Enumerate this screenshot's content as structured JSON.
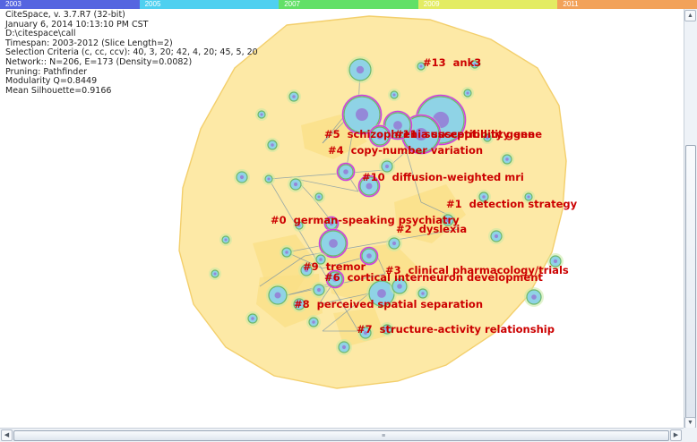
{
  "timeline": {
    "years": [
      {
        "label": "2003",
        "color": "#5565e0"
      },
      {
        "label": "2005",
        "color": "#4fd0f0"
      },
      {
        "label": "2007",
        "color": "#62e067"
      },
      {
        "label": "2009",
        "color": "#e3ec63"
      },
      {
        "label": "2011",
        "color": "#f2a25a"
      }
    ]
  },
  "info": {
    "title": "CiteSpace, v. 3.7.R7 (32-bit)",
    "date": "January 6, 2014 10:13:10 PM CST",
    "path": "D:\\citespace\\call",
    "timespan": "Timespan: 2003-2012 (Slice Length=2)",
    "criteria": "Selection Criteria (c, cc, ccv): 40, 3, 20; 42, 4, 20; 45, 5, 20",
    "network": "Network:: N=206, E=173 (Density=0.0082)",
    "pruning": "Pruning: Pathfinder",
    "modularity": "Modularity Q=0.8449",
    "silhouette": "Mean Silhouette=0.9166"
  },
  "clusters": [
    {
      "id": "#13",
      "label": "ank3"
    },
    {
      "id": "#11",
      "label": "susceptibility gene"
    },
    {
      "id": "#5",
      "label": "schizophrenia susceptibility gene"
    },
    {
      "id": "#4",
      "label": "copy-number variation"
    },
    {
      "id": "#10",
      "label": "diffusion-weighted mri"
    },
    {
      "id": "#1",
      "label": "detection strategy"
    },
    {
      "id": "#0",
      "label": "german-speaking psychiatry"
    },
    {
      "id": "#2",
      "label": "dyslexia"
    },
    {
      "id": "#9",
      "label": "tremor"
    },
    {
      "id": "#3",
      "label": "clinical pharmacology/trials"
    },
    {
      "id": "#6",
      "label": "cortical interneuron development"
    },
    {
      "id": "#8",
      "label": "perceived spatial separation"
    },
    {
      "id": "#7",
      "label": "structure-activity relationship"
    }
  ],
  "colors": {
    "hull": "#fde9a6",
    "hull_border": "#f3cf6c",
    "label": "#cc0000",
    "link": "#6f8ea6",
    "node_ring": "#d43ae0"
  },
  "scrollbars": {
    "up_icon": "▲",
    "down_icon": "▼",
    "left_icon": "◀",
    "right_icon": "▶",
    "grip_icon": "≡"
  }
}
